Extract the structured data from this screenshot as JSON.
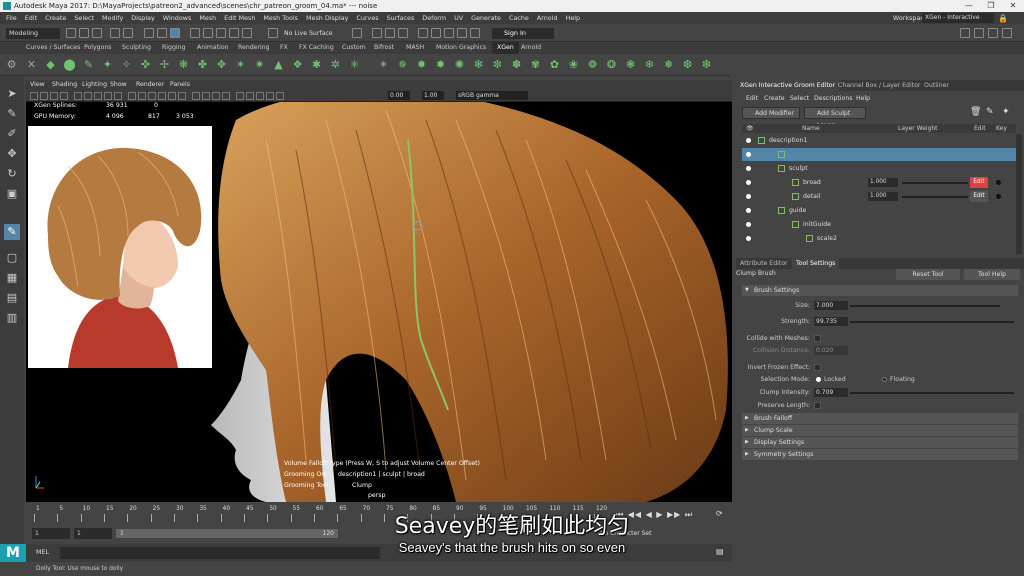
{
  "window": {
    "title": "Autodesk Maya 2017: D:\\MayaProjects\\patreon2_advanced\\scenes\\chr_patreon_groom_04.ma*  ---  noise"
  },
  "menubar": {
    "items": [
      "File",
      "Edit",
      "Create",
      "Select",
      "Modify",
      "Display",
      "Windows",
      "Mesh",
      "Edit Mesh",
      "Mesh Tools",
      "Mesh Display",
      "Curves",
      "Surfaces",
      "Deform",
      "UV",
      "Generate",
      "Cache",
      "Arnold",
      "Help"
    ],
    "workspace_label": "Workspace :",
    "workspace_value": "XGen - Interactive Groom*"
  },
  "statusline": {
    "mode": "Modeling",
    "live_surface": "No Live Surface",
    "signin": "Sign In"
  },
  "shelf_tabs": [
    "Curves / Surfaces",
    "Polygons",
    "Sculpting",
    "Rigging",
    "Animation",
    "Rendering",
    "FX",
    "FX Caching",
    "Custom",
    "Bifrost",
    "MASH",
    "Motion Graphics",
    "XGen",
    "Arnold"
  ],
  "shelf_active": "XGen",
  "viewport": {
    "menu": [
      "View",
      "Shading",
      "Lighting",
      "Show",
      "Renderer",
      "Panels"
    ],
    "field_a": "0.00",
    "field_b": "1.00",
    "colorspace": "sRGB gamma",
    "hud": {
      "xgen_splines_label": "XGen Splines:",
      "xgen_splines_a": "36 931",
      "xgen_splines_b": "0",
      "gpu_memory_label": "GPU Memory:",
      "gpu_memory_a": "4 096",
      "gpu_memory_b": "817",
      "gpu_memory_c": "3 053"
    },
    "info": {
      "line1": "Volume Falloff Type (Press W, S to adjust Volume Center Offset)",
      "grooming_on_label": "Grooming On:",
      "grooming_on_value": "description1 | sculpt | broad",
      "grooming_tool_label": "Grooming Tool:",
      "grooming_tool_value": "Clump",
      "persp": "persp"
    }
  },
  "xgen_editor": {
    "tabs": [
      "XGen Interactive Groom Editor",
      "Channel Box / Layer Editor",
      "Outliner"
    ],
    "menu": [
      "Edit",
      "Create",
      "Select",
      "Descriptions",
      "Help"
    ],
    "add_modifier": "Add Modifier",
    "add_sculpt_layer": "Add Sculpt Layer",
    "headers": {
      "name": "Name",
      "layer_weight": "Layer Weight",
      "edit": "Edit",
      "key": "Key"
    },
    "rows": [
      {
        "label": "description1",
        "indent": 16
      },
      {
        "label": "",
        "indent": 36,
        "selected": true
      },
      {
        "label": "sculpt",
        "indent": 36
      },
      {
        "label": "broad",
        "indent": 50,
        "weight": "1.000",
        "edit": "Edit",
        "edit_color": "#e04040"
      },
      {
        "label": "detail",
        "indent": 50,
        "weight": "1.000",
        "edit": "Edit",
        "edit_color": "#555555"
      },
      {
        "label": "guide",
        "indent": 36
      },
      {
        "label": "initGuide",
        "indent": 50
      },
      {
        "label": "scale2",
        "indent": 64
      }
    ]
  },
  "attr_editor": {
    "tabs": [
      "Attribute Editor",
      "Tool Settings"
    ],
    "tool_name": "Clump Brush",
    "reset_tool": "Reset Tool",
    "tool_help": "Tool Help",
    "brush_settings": "Brush Settings",
    "size_label": "Size:",
    "size_value": "7.000",
    "strength_label": "Strength:",
    "strength_value": "99.735",
    "collide_label": "Collide with Meshes:",
    "collision_label": "Collision Distance:",
    "collision_value": "0.020",
    "invert_label": "Invert Frozen Effect:",
    "selection_label": "Selection Mode:",
    "locked": "Locked",
    "floating": "Floating",
    "clump_label": "Clump Intensity:",
    "clump_value": "0.709",
    "preserve_label": "Preserve Length:",
    "sections": [
      "Brush Falloff",
      "Clump Scale",
      "Display Settings",
      "Symmetry Settings"
    ]
  },
  "timeline": {
    "ticks": [
      "1",
      "5",
      "10",
      "15",
      "20",
      "25",
      "30",
      "35",
      "40",
      "45",
      "50",
      "55",
      "60",
      "65",
      "70",
      "75",
      "80",
      "85",
      "90",
      "95",
      "100",
      "105",
      "110",
      "115",
      "120"
    ],
    "range_start": "1",
    "range_start2": "1",
    "range_inner_start": "1",
    "range_inner_end": "120",
    "no_character_set": "No Character Set"
  },
  "mel": {
    "label": "MEL"
  },
  "helpline": "Dolly Tool: Use mouse to dolly",
  "subtitle": {
    "chinese": "Seavey的笔刷如此均匀",
    "english": "Seavey's that the brush hits on so even"
  }
}
